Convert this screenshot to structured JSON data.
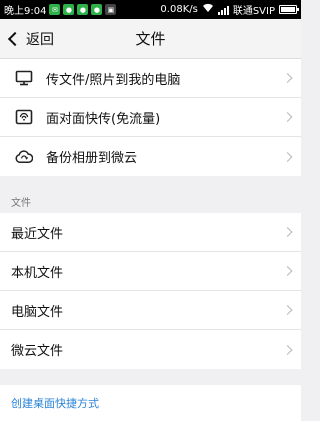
{
  "status_bar": {
    "time": "晚上9:04",
    "network_speed": "0.08K/s",
    "carrier": "联通SVIP",
    "battery_percent": 100,
    "notification_icons": [
      "message-icon",
      "wechat-icon",
      "wechat-icon",
      "wechat-icon",
      "photo-icon"
    ]
  },
  "header": {
    "back_label": "返回",
    "title": "文件"
  },
  "transfer_items": [
    {
      "label": "传文件/照片到我的电脑",
      "icon": "monitor-icon"
    },
    {
      "label": "面对面快传(免流量)",
      "icon": "wifi-transfer-icon"
    },
    {
      "label": "备份相册到微云",
      "icon": "cloud-backup-icon"
    }
  ],
  "files_section": {
    "label": "文件",
    "items": [
      {
        "label": "最近文件"
      },
      {
        "label": "本机文件"
      },
      {
        "label": "电脑文件"
      },
      {
        "label": "微云文件"
      }
    ]
  },
  "shortcut_link": "创建桌面快捷方式",
  "colors": {
    "link": "#2a83d6",
    "background": "#f0f0f2",
    "statusbar": "#000000"
  }
}
